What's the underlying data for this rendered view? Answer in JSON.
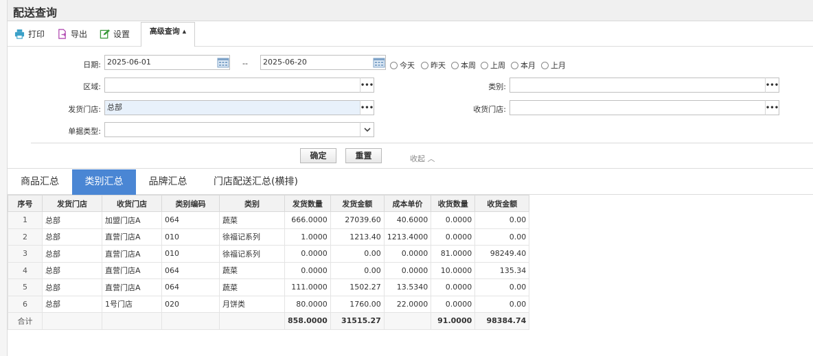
{
  "window": {
    "title": "配送查询"
  },
  "toolbar": {
    "print_label": "打印",
    "export_label": "导出",
    "settings_label": "设置",
    "advanced_label": "高级查询 ▴"
  },
  "form": {
    "date_label": "日期:",
    "date_from": "2025-06-01",
    "date_sep": "--",
    "date_to": "2025-06-20",
    "quick_ranges": [
      "今天",
      "昨天",
      "本周",
      "上周",
      "本月",
      "上月"
    ],
    "region_label": "区域:",
    "region_value": "",
    "category_label": "类别:",
    "category_value": "",
    "ship_store_label": "发货门店:",
    "ship_store_value": "总部",
    "recv_store_label": "收货门店:",
    "recv_store_value": "",
    "doc_type_label": "单据类型:",
    "doc_type_value": "",
    "confirm_label": "确定",
    "reset_label": "重置",
    "collapse_label": "收起 ︿"
  },
  "tabs": [
    {
      "label": "商品汇总",
      "active": false
    },
    {
      "label": "类别汇总",
      "active": true
    },
    {
      "label": "品牌汇总",
      "active": false
    },
    {
      "label": "门店配送汇总(横排)",
      "active": false
    }
  ],
  "table": {
    "headers": [
      "序号",
      "发货门店",
      "收货门店",
      "类别编码",
      "类别",
      "发货数量",
      "发货金额",
      "成本单价",
      "收货数量",
      "收货金额"
    ],
    "rows": [
      [
        "1",
        "总部",
        "加盟门店A",
        "064",
        "蔬菜",
        "666.0000",
        "27039.60",
        "40.6000",
        "0.0000",
        "0.00"
      ],
      [
        "2",
        "总部",
        "直营门店A",
        "010",
        "徐福记系列",
        "1.0000",
        "1213.40",
        "1213.4000",
        "0.0000",
        "0.00"
      ],
      [
        "3",
        "总部",
        "直营门店A",
        "010",
        "徐福记系列",
        "0.0000",
        "0.00",
        "0.0000",
        "81.0000",
        "98249.40"
      ],
      [
        "4",
        "总部",
        "直营门店A",
        "064",
        "蔬菜",
        "0.0000",
        "0.00",
        "0.0000",
        "10.0000",
        "135.34"
      ],
      [
        "5",
        "总部",
        "直营门店A",
        "064",
        "蔬菜",
        "111.0000",
        "1502.27",
        "13.5340",
        "0.0000",
        "0.00"
      ],
      [
        "6",
        "总部",
        "1号门店",
        "020",
        "月饼类",
        "80.0000",
        "1760.00",
        "22.0000",
        "0.0000",
        "0.00"
      ]
    ],
    "total": [
      "合计",
      "",
      "",
      "",
      "",
      "858.0000",
      "31515.27",
      "",
      "91.0000",
      "98384.74"
    ]
  }
}
